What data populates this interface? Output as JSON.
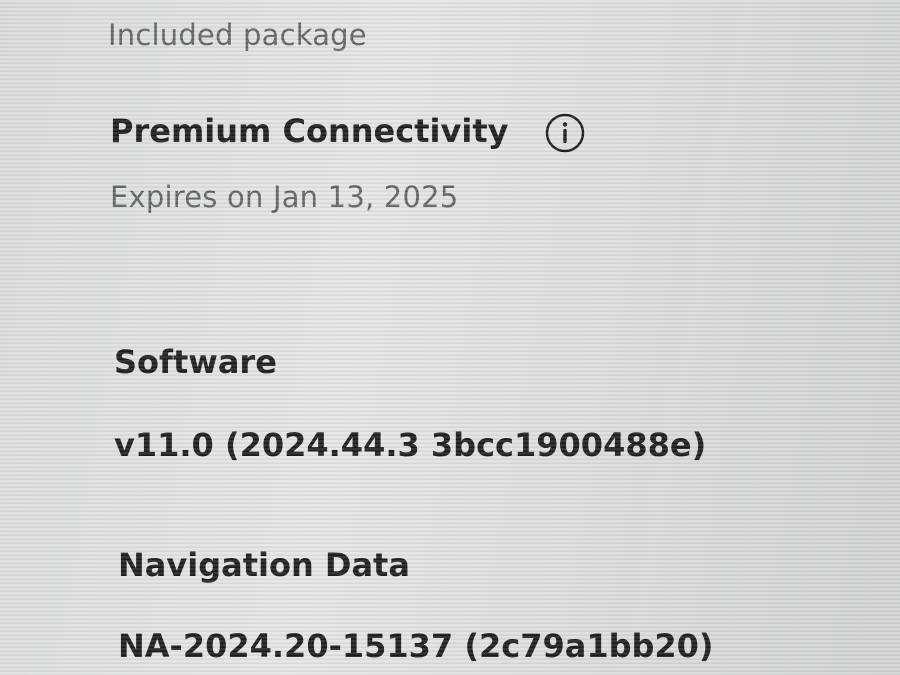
{
  "package": {
    "section_label": "Included package",
    "name": "Premium Connectivity",
    "info_icon": "info-icon",
    "expiry": "Expires on Jan 13, 2025"
  },
  "software": {
    "heading": "Software",
    "version": "v11.0 (2024.44.3 3bcc1900488e)"
  },
  "navigation": {
    "heading": "Navigation Data",
    "version": "NA-2024.20-15137 (2c79a1bb20)"
  }
}
